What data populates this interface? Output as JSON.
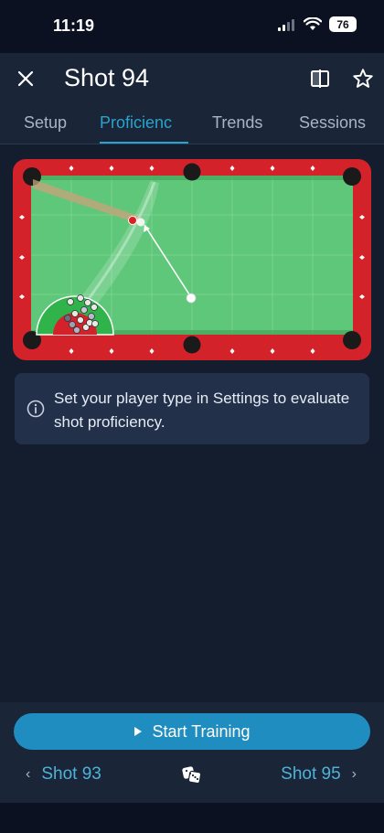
{
  "status": {
    "time": "11:19",
    "battery": "76"
  },
  "header": {
    "title": "Shot 94",
    "tabs": [
      {
        "label": "Setup"
      },
      {
        "label": "Proficienc"
      },
      {
        "label": "Trends"
      },
      {
        "label": "Sessions"
      }
    ]
  },
  "info": {
    "text": "Set your player type in Settings to evaluate shot proficiency."
  },
  "footer": {
    "start_label": "Start Training",
    "prev_label": "Shot 93",
    "next_label": "Shot 95"
  },
  "colors": {
    "accent": "#2aa3cc",
    "felt": "#5fc779",
    "rail": "#d3222a",
    "background": "#131d2e",
    "button": "#1f8dbf"
  },
  "icons": [
    "close-icon",
    "compare-icon",
    "star-icon",
    "info-icon",
    "play-icon",
    "chevron-left-icon",
    "chevron-right-icon",
    "dice-icon"
  ]
}
